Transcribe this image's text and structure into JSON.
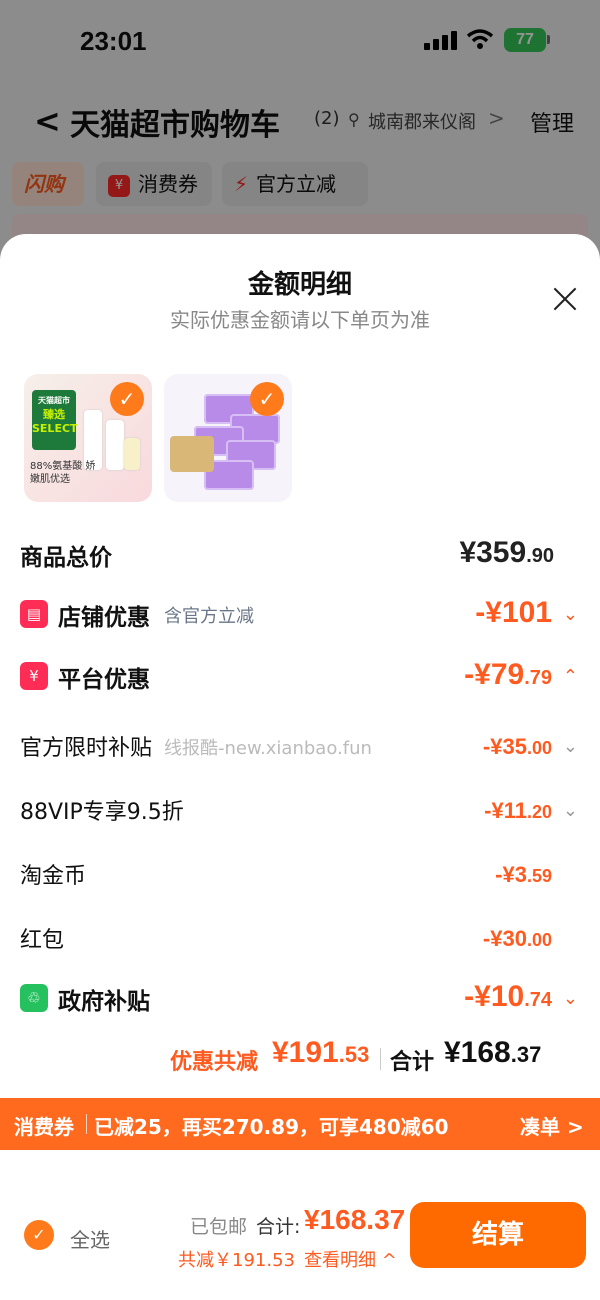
{
  "status_bar": {
    "time": "23:01",
    "battery": "77"
  },
  "nav": {
    "back": "<",
    "title": "天猫超市购物车",
    "count": "(2)",
    "location": "城南郡来仪阁",
    "location_arrow": ">",
    "manage": "管理"
  },
  "chips": {
    "flash": "闪购",
    "coupon": "消费券",
    "coupon_icon": "¥",
    "gov": "官方立减"
  },
  "sheet": {
    "title": "金额明细",
    "subtitle": "实际优惠金额请以下单页为准",
    "close_icon": "close-icon"
  },
  "items": [
    {
      "badge_top": "天猫超市",
      "badge": "臻选 SELECT",
      "caption": "88%氨基酸 娇嫩肌优选",
      "checked": true
    },
    {
      "checked": true
    }
  ],
  "breakdown": {
    "subtotal": {
      "label": "商品总价",
      "amount_int": "¥359",
      "amount_dec": ".90"
    },
    "store": {
      "label": "店铺优惠",
      "note": "含官方立减",
      "amount_int": "-¥101",
      "amount_dec": ""
    },
    "platform": {
      "label": "平台优惠",
      "amount_int": "-¥79",
      "amount_dec": ".79"
    },
    "official": {
      "label": "官方限时补贴",
      "watermark": "线报酷-new.xianbao.fun",
      "amount_int": "-¥35",
      "amount_dec": ".00"
    },
    "vip": {
      "label": "88VIP专享9.5折",
      "amount_int": "-¥11",
      "amount_dec": ".20"
    },
    "coin": {
      "label": "淘金币",
      "amount_int": "-¥3",
      "amount_dec": ".59"
    },
    "redpack": {
      "label": "红包",
      "amount_int": "-¥30",
      "amount_dec": ".00"
    },
    "gov": {
      "label": "政府补贴",
      "amount_int": "-¥10",
      "amount_dec": ".74"
    }
  },
  "totals": {
    "save_label": "优惠共减",
    "save_int": "¥191",
    "save_dec": ".53",
    "sum_label": "合计",
    "sum_int": "¥168",
    "sum_dec": ".37"
  },
  "promo": {
    "tag": "消费券",
    "text": "已减25，再买270.89，可享480减60",
    "go": "凑单 >"
  },
  "footer": {
    "select_all": "全选",
    "shipping": "已包邮",
    "pay_label": "合计:",
    "pay_value": "¥168.37",
    "saved": "共减￥191.53",
    "detail": "查看明细 ^",
    "checkout": "结算"
  },
  "colors": {
    "accent": "#ff5a1f",
    "checkout": "#ff6a00",
    "promo_bar": "#ff6a1f"
  }
}
